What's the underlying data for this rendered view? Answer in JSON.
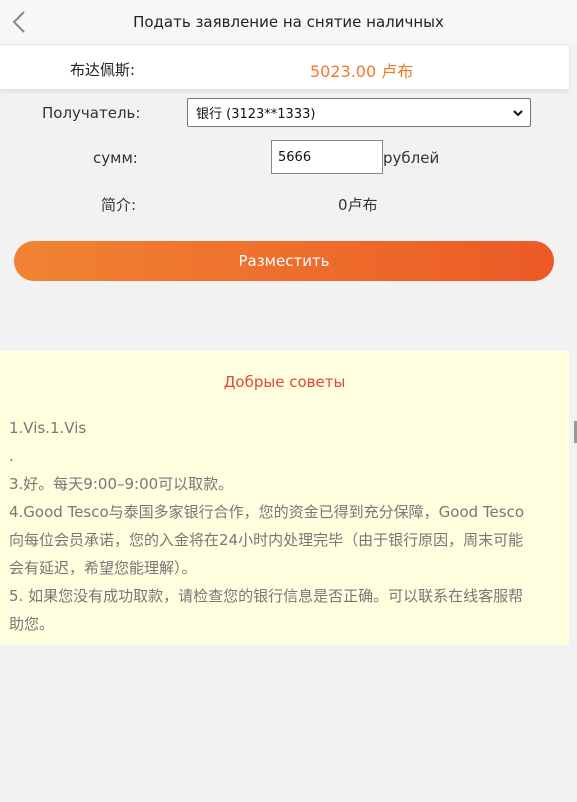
{
  "header": {
    "title": "Подать заявление на снятие наличных",
    "back_icon": "chevron-left-icon"
  },
  "balance": {
    "label": "布达佩斯:",
    "value": "5023.00 卢布"
  },
  "form": {
    "recipient_label": "Получатель:",
    "recipient_selected": "银行 (3123**1333)",
    "amount_label": "сумм:",
    "amount_value": "5666",
    "amount_unit": "рублей",
    "fee_label": "简介:",
    "fee_value": "0卢布",
    "submit_label": "Разместить"
  },
  "tips": {
    "title": "Добрые советы",
    "lines": [
      "1.Vis.1.Vis",
      ".",
      "3.好。每天9:00–9:00可以取款。",
      "4.Good Tesco与泰国多家银行合作，您的资金已得到充分保障，Good Tesco",
      "向每位会员承诺，您的入金将在24小时内处理完毕（由于银行原因，周末可能",
      "会有延迟，希望您能理解）。",
      "5. 如果您没有成功取款，请检查您的银行信息是否正确。可以联系在线客服帮",
      "助您。"
    ]
  },
  "colors": {
    "accent": "#f07a2a",
    "button_start": "#f18332",
    "button_end": "#ec5a26",
    "tips_title": "#e0493a",
    "tips_bg": "#ffffe0"
  }
}
